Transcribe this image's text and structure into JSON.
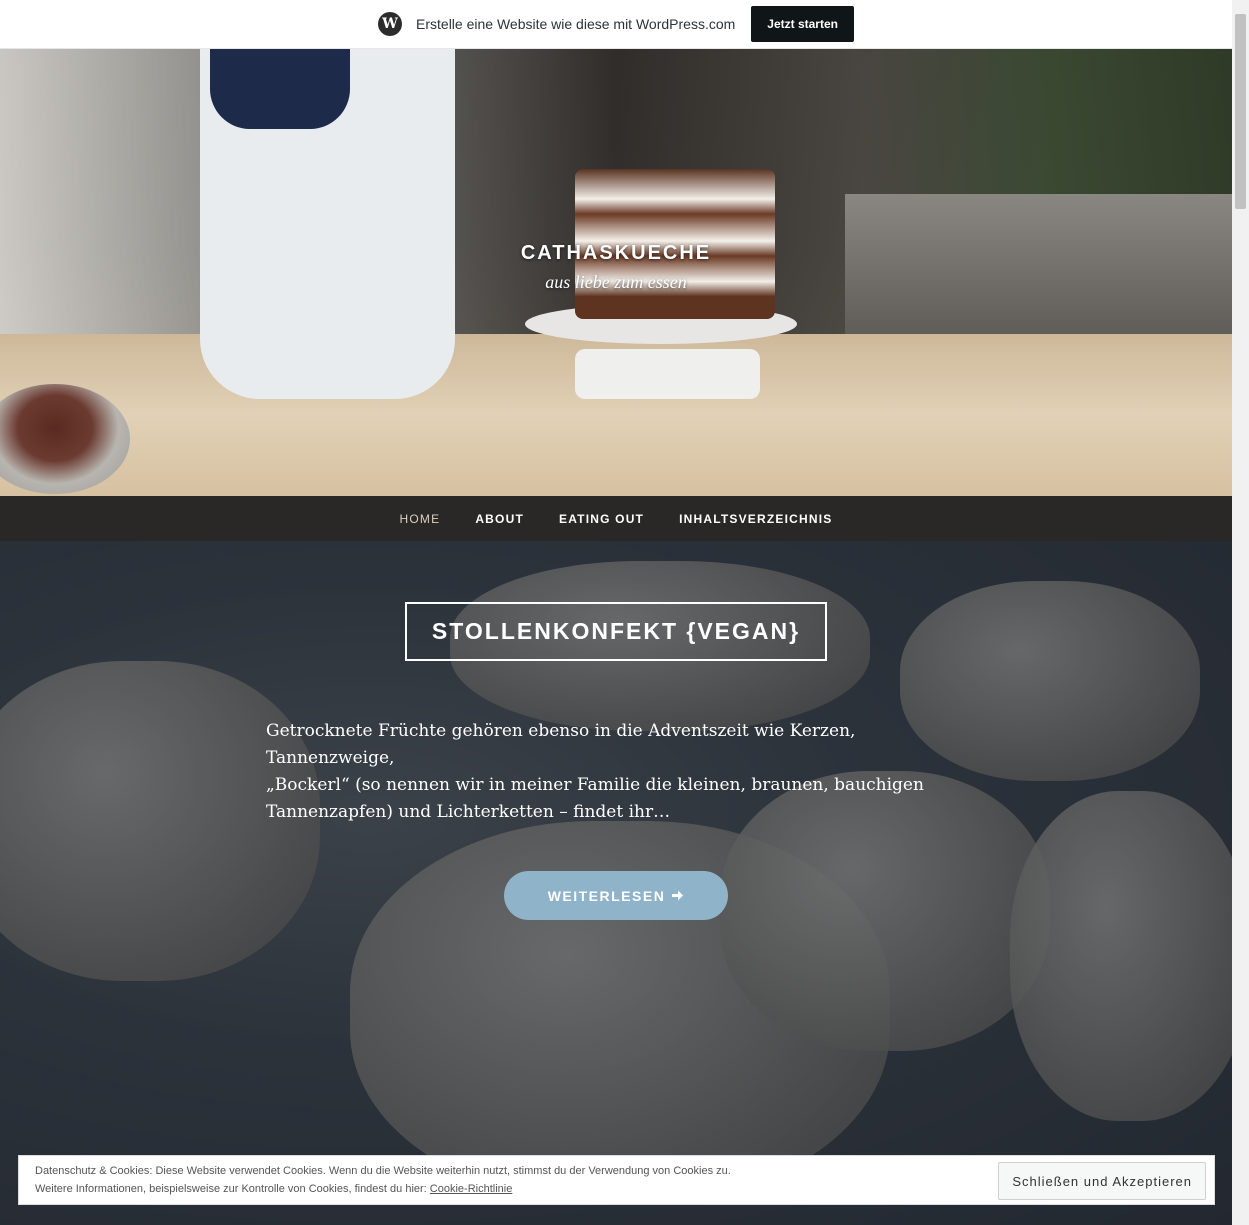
{
  "wpbar": {
    "text": "Erstelle eine Website wie diese mit WordPress.com",
    "button": "Jetzt starten",
    "logo_icon": "wordpress-logo-icon"
  },
  "site": {
    "title": "CATHASKUECHE",
    "tagline": "aus liebe zum essen"
  },
  "nav": {
    "items": [
      {
        "label": "HOME",
        "active": true
      },
      {
        "label": "ABOUT"
      },
      {
        "label": "EATING OUT"
      },
      {
        "label": "INHALTSVERZEICHNIS"
      }
    ]
  },
  "featured": {
    "title": "STOLLENKONFEKT {VEGAN}",
    "excerpt_line1": "Getrocknete Früchte gehören ebenso in die Adventszeit wie Kerzen, Tannenzweige,",
    "excerpt_line2": "„Bockerl“ (so nennen wir in meiner Familie die kleinen, braunen, bauchigen",
    "excerpt_line3": "Tannenzapfen) und Lichterketten – findet ihr…",
    "readmore": "WEITERLESEN",
    "readmore_icon": "arrow-right-icon"
  },
  "cookie": {
    "line1": "Datenschutz & Cookies: Diese Website verwendet Cookies. Wenn du die Website weiterhin nutzt, stimmst du der Verwendung von Cookies zu.",
    "line2_prefix": "Weitere Informationen, beispielsweise zur Kontrolle von Cookies, findest du hier:",
    "link": "Cookie-Richtlinie",
    "button": "Schließen und Akzeptieren"
  },
  "colors": {
    "nav_bg": "#2a2826",
    "button_accent": "#8fb3c9",
    "wp_button": "#101517"
  }
}
